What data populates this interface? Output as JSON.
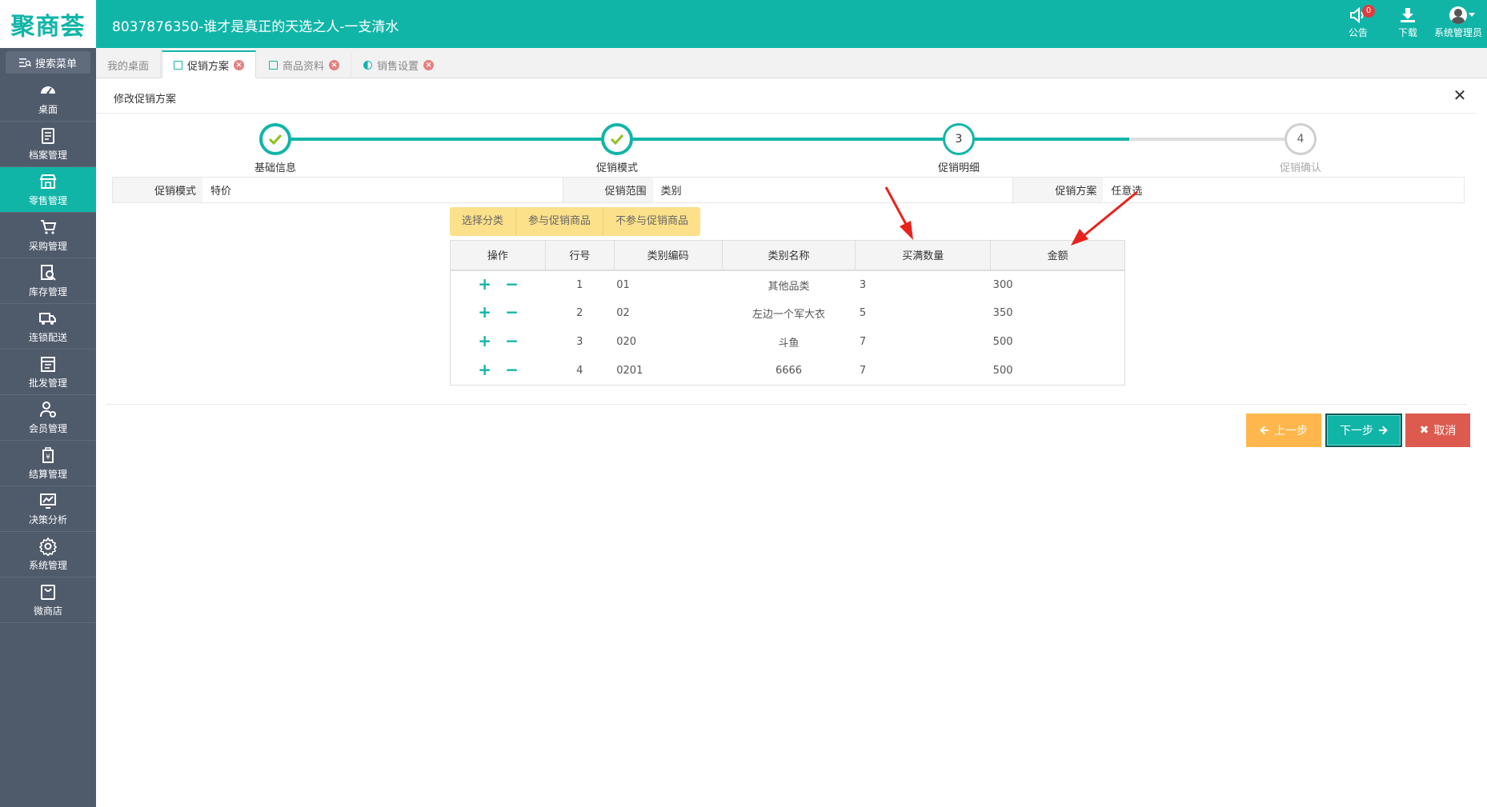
{
  "app": {
    "logo": "聚商荟",
    "title": "8037876350-谁才是真正的天选之人-一支清水"
  },
  "top_actions": {
    "notice_label": "公告",
    "notice_count": "0",
    "download_label": "下载",
    "user_label": "系统管理员"
  },
  "sidebar": {
    "search_label": "搜索菜单",
    "items": [
      {
        "label": "桌面",
        "icon": "dashboard-icon"
      },
      {
        "label": "档案管理",
        "icon": "document-icon"
      },
      {
        "label": "零售管理",
        "icon": "store-icon",
        "active": true
      },
      {
        "label": "采购管理",
        "icon": "cart-icon"
      },
      {
        "label": "库存管理",
        "icon": "inventory-search-icon"
      },
      {
        "label": "连锁配送",
        "icon": "truck-icon"
      },
      {
        "label": "批发管理",
        "icon": "wholesale-icon"
      },
      {
        "label": "会员管理",
        "icon": "member-icon"
      },
      {
        "label": "结算管理",
        "icon": "settlement-icon"
      },
      {
        "label": "决策分析",
        "icon": "analytics-icon"
      },
      {
        "label": "系统管理",
        "icon": "gear-icon"
      },
      {
        "label": "微商店",
        "icon": "shop-bag-icon"
      }
    ]
  },
  "tabs": [
    {
      "label": "我的桌面"
    },
    {
      "label": "促销方案",
      "active": true
    },
    {
      "label": "商品资料"
    },
    {
      "label": "销售设置"
    }
  ],
  "panel": {
    "title": "修改促销方案"
  },
  "steps": [
    {
      "label": "基础信息",
      "state": "done"
    },
    {
      "label": "促销模式",
      "state": "done"
    },
    {
      "label": "促销明细",
      "state": "current",
      "number": "3"
    },
    {
      "label": "促销确认",
      "state": "todo",
      "number": "4"
    }
  ],
  "info": {
    "mode_label": "促销模式",
    "mode_value": "特价",
    "scope_label": "促销范围",
    "scope_value": "类别",
    "plan_label": "促销方案",
    "plan_value": "任意选"
  },
  "button_group": {
    "choose_category": "选择分类",
    "join_goods": "参与促销商品",
    "exclude_goods": "不参与促销商品"
  },
  "table": {
    "headers": [
      "操作",
      "行号",
      "类别编码",
      "类别名称",
      "买满数量",
      "金额"
    ],
    "rows": [
      {
        "row": "1",
        "code": "01",
        "name": "其他品类",
        "qty": "3",
        "amount": "300"
      },
      {
        "row": "2",
        "code": "02",
        "name": "左边一个军大衣",
        "qty": "5",
        "amount": "350"
      },
      {
        "row": "3",
        "code": "020",
        "name": "斗鱼",
        "qty": "7",
        "amount": "500"
      },
      {
        "row": "4",
        "code": "0201",
        "name": "6666",
        "qty": "7",
        "amount": "500"
      }
    ]
  },
  "footer": {
    "prev": "上一步",
    "next": "下一步",
    "cancel": "取消"
  },
  "colors": {
    "accent": "#11b5a8",
    "sidebar": "#4f5a6b",
    "warning": "#ffb74d",
    "danger": "#dc5b4e",
    "annotation": "#e8231d"
  }
}
